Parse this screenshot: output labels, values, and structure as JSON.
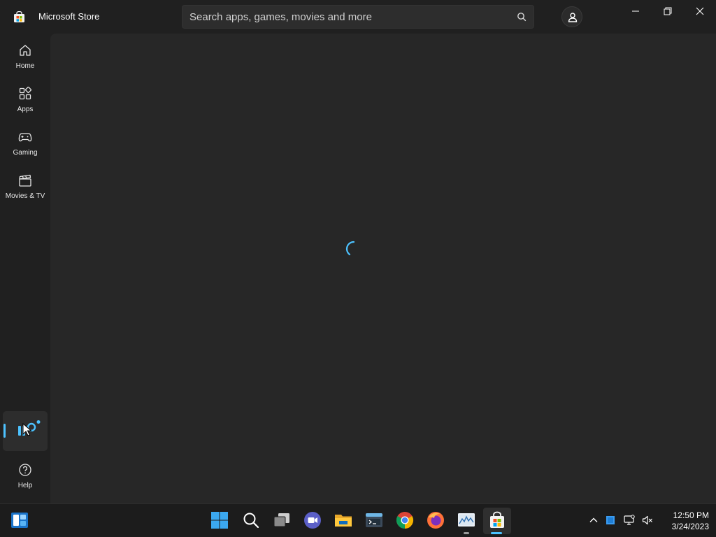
{
  "window": {
    "app_title": "Microsoft Store",
    "search_placeholder": "Search apps, games, movies and more"
  },
  "icons": {
    "app": "store-icon",
    "search": "search-icon",
    "account": "account-icon",
    "minimize": "minimize-icon",
    "restore": "restore-icon",
    "close": "close-icon",
    "spinner": "loading-spinner-icon"
  },
  "sidebar": {
    "items": [
      {
        "label": "Home",
        "icon": "home-icon"
      },
      {
        "label": "Apps",
        "icon": "apps-icon"
      },
      {
        "label": "Gaming",
        "icon": "gaming-icon"
      },
      {
        "label": "Movies & TV",
        "icon": "movies-icon"
      }
    ],
    "library": {
      "icon": "library-icon",
      "selected": true
    },
    "help": {
      "label": "Help",
      "icon": "help-icon"
    }
  },
  "taskbar": {
    "apps": [
      "widgets-icon",
      "start-icon",
      "search-icon",
      "task-view-icon",
      "chat-icon",
      "file-explorer-icon",
      "terminal-icon",
      "chrome-icon",
      "firefox-icon",
      "monitor-app-icon",
      "store-icon"
    ],
    "tray": [
      "chevron-up-icon",
      "app-tray-icon",
      "network-icon",
      "volume-muted-icon"
    ],
    "time": "12:50 PM",
    "date": "3/24/2023"
  },
  "colors": {
    "accent": "#4cc2ff",
    "background": "#202020",
    "content": "#272727"
  }
}
